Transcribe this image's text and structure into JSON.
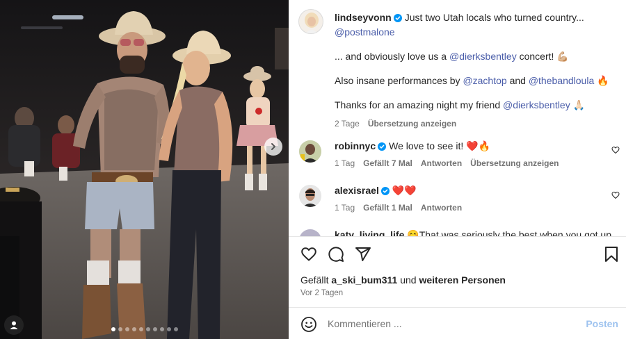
{
  "post": {
    "author": "lindseyvonn",
    "caption": {
      "line1": "Just two Utah locals who turned country...",
      "mention1": "@postmalone",
      "line2_pre": "... and obviously love us a",
      "mention2": "@dierksbentley",
      "line2_post": "concert!",
      "line2_emoji": "💪🏼",
      "line3_pre": "Also insane performances by",
      "mention3": "@zachtop",
      "line3_mid": "and",
      "mention4": "@thebandloula",
      "line3_emoji": "🔥",
      "line4_pre": "Thanks for an amazing night my friend",
      "mention5": "@dierksbentley",
      "line4_emoji": "🙏🏻"
    },
    "caption_meta": {
      "time": "2 Tage",
      "translate": "Übersetzung anzeigen"
    },
    "carousel": {
      "total": 10,
      "active_index": 0
    }
  },
  "comments": [
    {
      "username": "robinnyc",
      "text": "We love to see it!",
      "emoji": "❤️🔥",
      "time": "1 Tag",
      "likes": "Gefällt 7 Mal",
      "reply": "Antworten",
      "translate": "Übersetzung anzeigen"
    },
    {
      "username": "alexisrael",
      "text": "",
      "emoji": "❤️❤️",
      "time": "1 Tag",
      "likes": "Gefällt 1 Mal",
      "reply": "Antworten"
    },
    {
      "username": "katy_living_life",
      "emoji": "😊",
      "text": "That was seriously the best when you got up"
    }
  ],
  "actions": {
    "liked_by_prefix": "Gefällt",
    "liked_by_user": "a_ski_bum311",
    "liked_by_mid": "und",
    "liked_by_rest": "weiteren Personen",
    "posted": "Vor 2 Tagen"
  },
  "composer": {
    "placeholder": "Kommentieren ...",
    "post_label": "Posten"
  },
  "colors": {
    "verified": "#0095f6",
    "mention": "#4a5da9",
    "post_disabled": "#9ec3ef",
    "heart_red": "#e0182d"
  },
  "icons": [
    "chevron-right-icon",
    "user-tag-icon",
    "verified-icon",
    "heart-icon",
    "comment-icon",
    "share-icon",
    "bookmark-icon",
    "emoji-icon"
  ]
}
